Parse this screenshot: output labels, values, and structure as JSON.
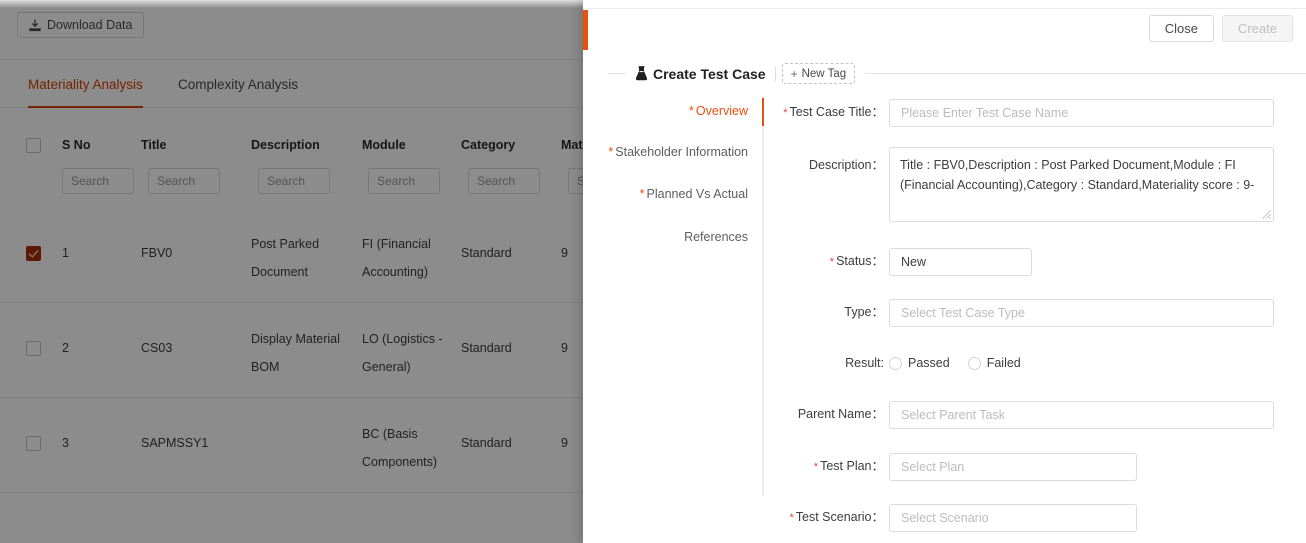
{
  "background": {
    "toolbar": {
      "download_label": "Download Data",
      "download_icon": "download-icon"
    },
    "tabs": [
      {
        "label": "Materiality Analysis",
        "active": true
      },
      {
        "label": "Complexity Analysis",
        "active": false
      }
    ],
    "table": {
      "columns": [
        "S No",
        "Title",
        "Description",
        "Module",
        "Category",
        "Mat"
      ],
      "search_placeholder": "Search",
      "rows": [
        {
          "selected": true,
          "s_no": "1",
          "title": "FBV0",
          "description": "Post Parked Document",
          "module": "FI (Financial Accounting)",
          "category": "Standard",
          "materiality": "9"
        },
        {
          "selected": false,
          "s_no": "2",
          "title": "CS03",
          "description": "Display Material BOM",
          "module": "LO (Logistics - General)",
          "category": "Standard",
          "materiality": "9"
        },
        {
          "selected": false,
          "s_no": "3",
          "title": "SAPMSSY1",
          "description": "",
          "module": "BC (Basis Components)",
          "category": "Standard",
          "materiality": "9"
        }
      ]
    }
  },
  "drawer": {
    "header": {
      "close_label": "Close",
      "create_label": "Create"
    },
    "section": {
      "title": "Create Test Case",
      "icon": "flask-icon",
      "new_tag_label": "New Tag"
    },
    "nav": [
      {
        "label": "Overview",
        "required": true,
        "active": true
      },
      {
        "label": "Stakeholder Information",
        "required": true,
        "active": false
      },
      {
        "label": "Planned Vs Actual",
        "required": true,
        "active": false
      },
      {
        "label": "References",
        "required": false,
        "active": false
      }
    ],
    "form": {
      "test_case_title": {
        "label": "Test Case Title：",
        "required": true,
        "value": "",
        "placeholder": "Please Enter Test Case Name"
      },
      "description": {
        "label": "Description：",
        "required": false,
        "value": "Title : FBV0,Description : Post Parked Document,Module : FI (Financial Accounting),Category : Standard,Materiality score : 9-"
      },
      "status": {
        "label": "Status：",
        "required": true,
        "value": "New"
      },
      "type": {
        "label": "Type：",
        "required": false,
        "value": "",
        "placeholder": "Select Test Case Type"
      },
      "result": {
        "label": "Result:",
        "required": false,
        "options": [
          {
            "label": "Passed",
            "selected": false
          },
          {
            "label": "Failed",
            "selected": false
          }
        ]
      },
      "parent_name": {
        "label": "Parent Name：",
        "required": false,
        "value": "",
        "placeholder": "Select Parent Task"
      },
      "test_plan": {
        "label": "Test Plan：",
        "required": true,
        "value": "",
        "placeholder": "Select Plan"
      },
      "test_scenario": {
        "label": "Test Scenario：",
        "required": true,
        "value": "",
        "placeholder": "Select Scenario"
      }
    }
  },
  "colors": {
    "accent_orange": "#e8500e",
    "tab_orange": "#d64000",
    "checkbox_selected": "#ab2f0b",
    "required_red": "#e8413a"
  }
}
